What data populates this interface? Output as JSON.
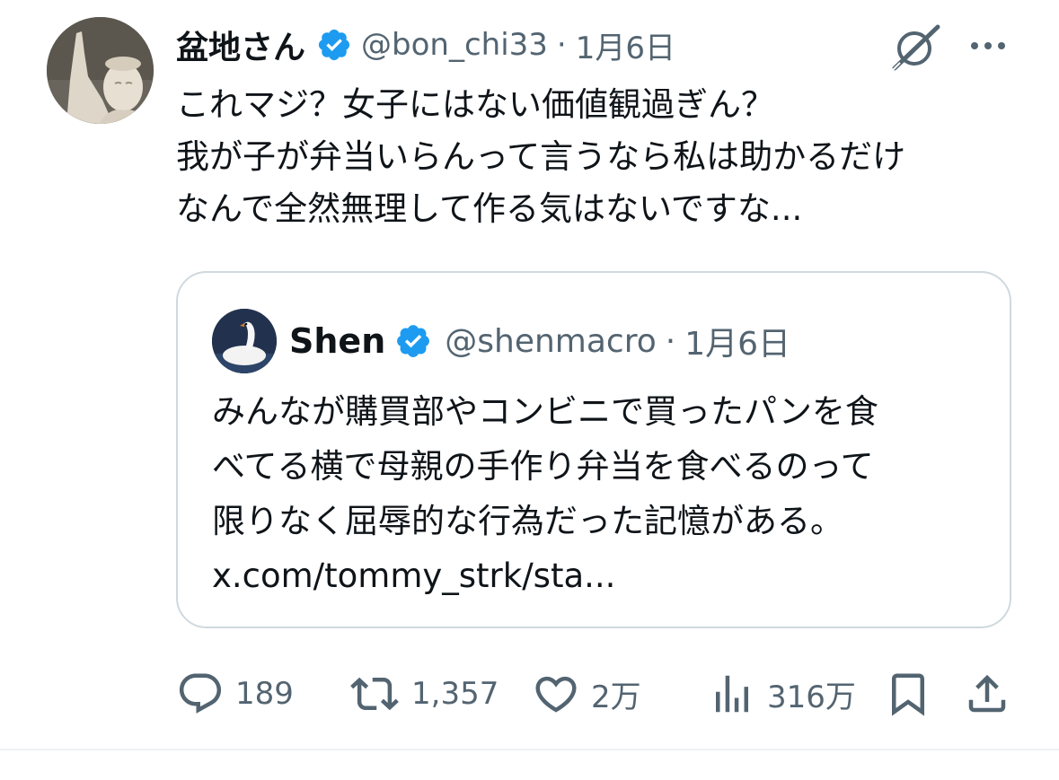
{
  "tweet": {
    "display_name": "盆地さん",
    "handle": "@bon_chi33",
    "separator": "·",
    "date": "1月6日",
    "text": "これマジ？女子にはない価値観過ぎん？\n我が子が弁当いらんって言うなら私は助かるだけ\nなんで全然無理して作る気はないですな..."
  },
  "quoted_tweet": {
    "display_name": "Shen",
    "handle": "@shenmacro",
    "separator": "·",
    "date": "1月6日",
    "text": "みんなが購買部やコンビニで買ったパンを食\nべてる横で母親の手作り弁当を食べるのって\n限りなく屈辱的な行為だった記憶がある。\nx.com/tommy_strk/sta..."
  },
  "actions": {
    "replies": "189",
    "retweets": "1,357",
    "likes": "2万",
    "views": "316万"
  },
  "icons": {
    "verified": "verified-badge-icon",
    "grok": "grok-icon",
    "more": "more-icon",
    "reply": "reply-icon",
    "retweet": "retweet-icon",
    "like": "heart-icon",
    "views": "views-icon",
    "bookmark": "bookmark-icon",
    "share": "share-icon"
  },
  "colors": {
    "verified_blue": "#1d9bf0",
    "text": "#0f1419",
    "secondary": "#536471",
    "border": "#cfd9de"
  }
}
